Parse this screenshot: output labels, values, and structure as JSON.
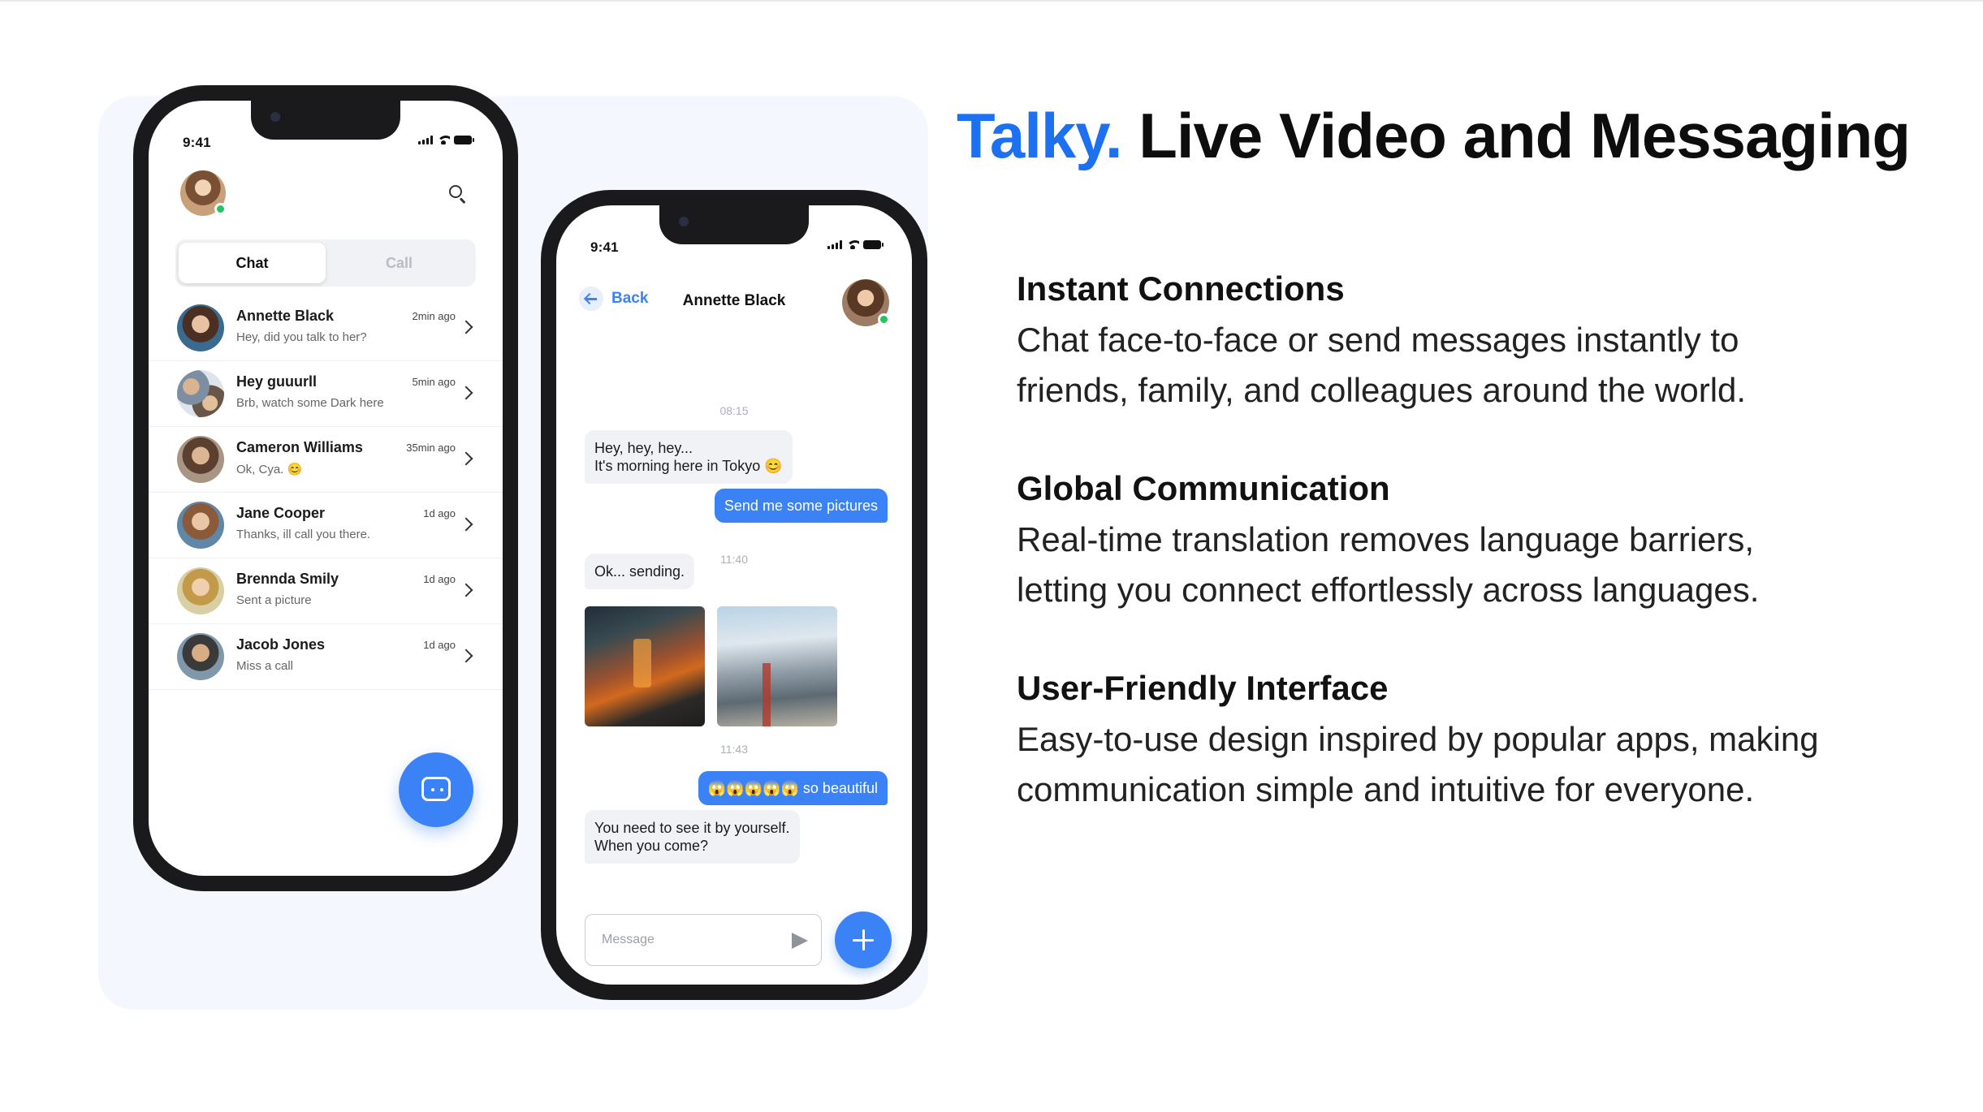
{
  "headline": {
    "brand": "Talky.",
    "rest": "Live Video and Messaging"
  },
  "features": [
    {
      "title": "Instant Connections",
      "body": "Chat face-to-face or send messages instantly to friends, family, and colleagues around the world."
    },
    {
      "title": "Global Communication",
      "body": "Real-time translation removes language barriers, letting you connect effortlessly across languages."
    },
    {
      "title": "User-Friendly Interface",
      "body": "Easy-to-use design inspired by popular apps, making communication simple and intuitive for everyone."
    }
  ],
  "phone_list": {
    "status_time": "9:41",
    "tabs": {
      "chat": "Chat",
      "call": "Call"
    },
    "chats": [
      {
        "name": "Annette Black",
        "time": "2min ago",
        "message": "Hey, did you talk to her?",
        "avatar_color": "#7a5a44"
      },
      {
        "name": "Hey guuurll",
        "time": "5min ago",
        "message": "Brb, watch some Dark here",
        "avatar_color": "#8fa3b8"
      },
      {
        "name": "Cameron Williams",
        "time": "35min ago",
        "message": "Ok, Cya. 😊",
        "avatar_color": "#8a6a55"
      },
      {
        "name": "Jane Cooper",
        "time": "1d ago",
        "message": "Thanks, ill call you there.",
        "avatar_color": "#6f8fa9"
      },
      {
        "name": "Brennda Smily",
        "time": "1d ago",
        "message": "Sent a picture",
        "avatar_color": "#c9b27a"
      },
      {
        "name": "Jacob Jones",
        "time": "1d ago",
        "message": "Miss a call",
        "avatar_color": "#6c7a84"
      }
    ]
  },
  "phone_chat": {
    "status_time": "9:41",
    "back_label": "Back",
    "contact_name": "Annette Black",
    "timestamps": [
      "08:15",
      "11:40",
      "11:43"
    ],
    "messages": {
      "in_1_line_1": "Hey, hey, hey...",
      "in_1_line_2": "It's morning here in Tokyo 😊",
      "out_1": "Send me some pictures",
      "in_2": "Ok... sending.",
      "out_2": "😱😱😱😱😱 so beautiful",
      "in_3_line_1": "You need to see it by yourself.",
      "in_3_line_2": "When you come?"
    },
    "composer_placeholder": "Message"
  },
  "colors": {
    "brand": "#1d70f0",
    "accent": "#3b82f6",
    "online": "#22c55e",
    "showcase_bg": "#f4f7fd"
  }
}
